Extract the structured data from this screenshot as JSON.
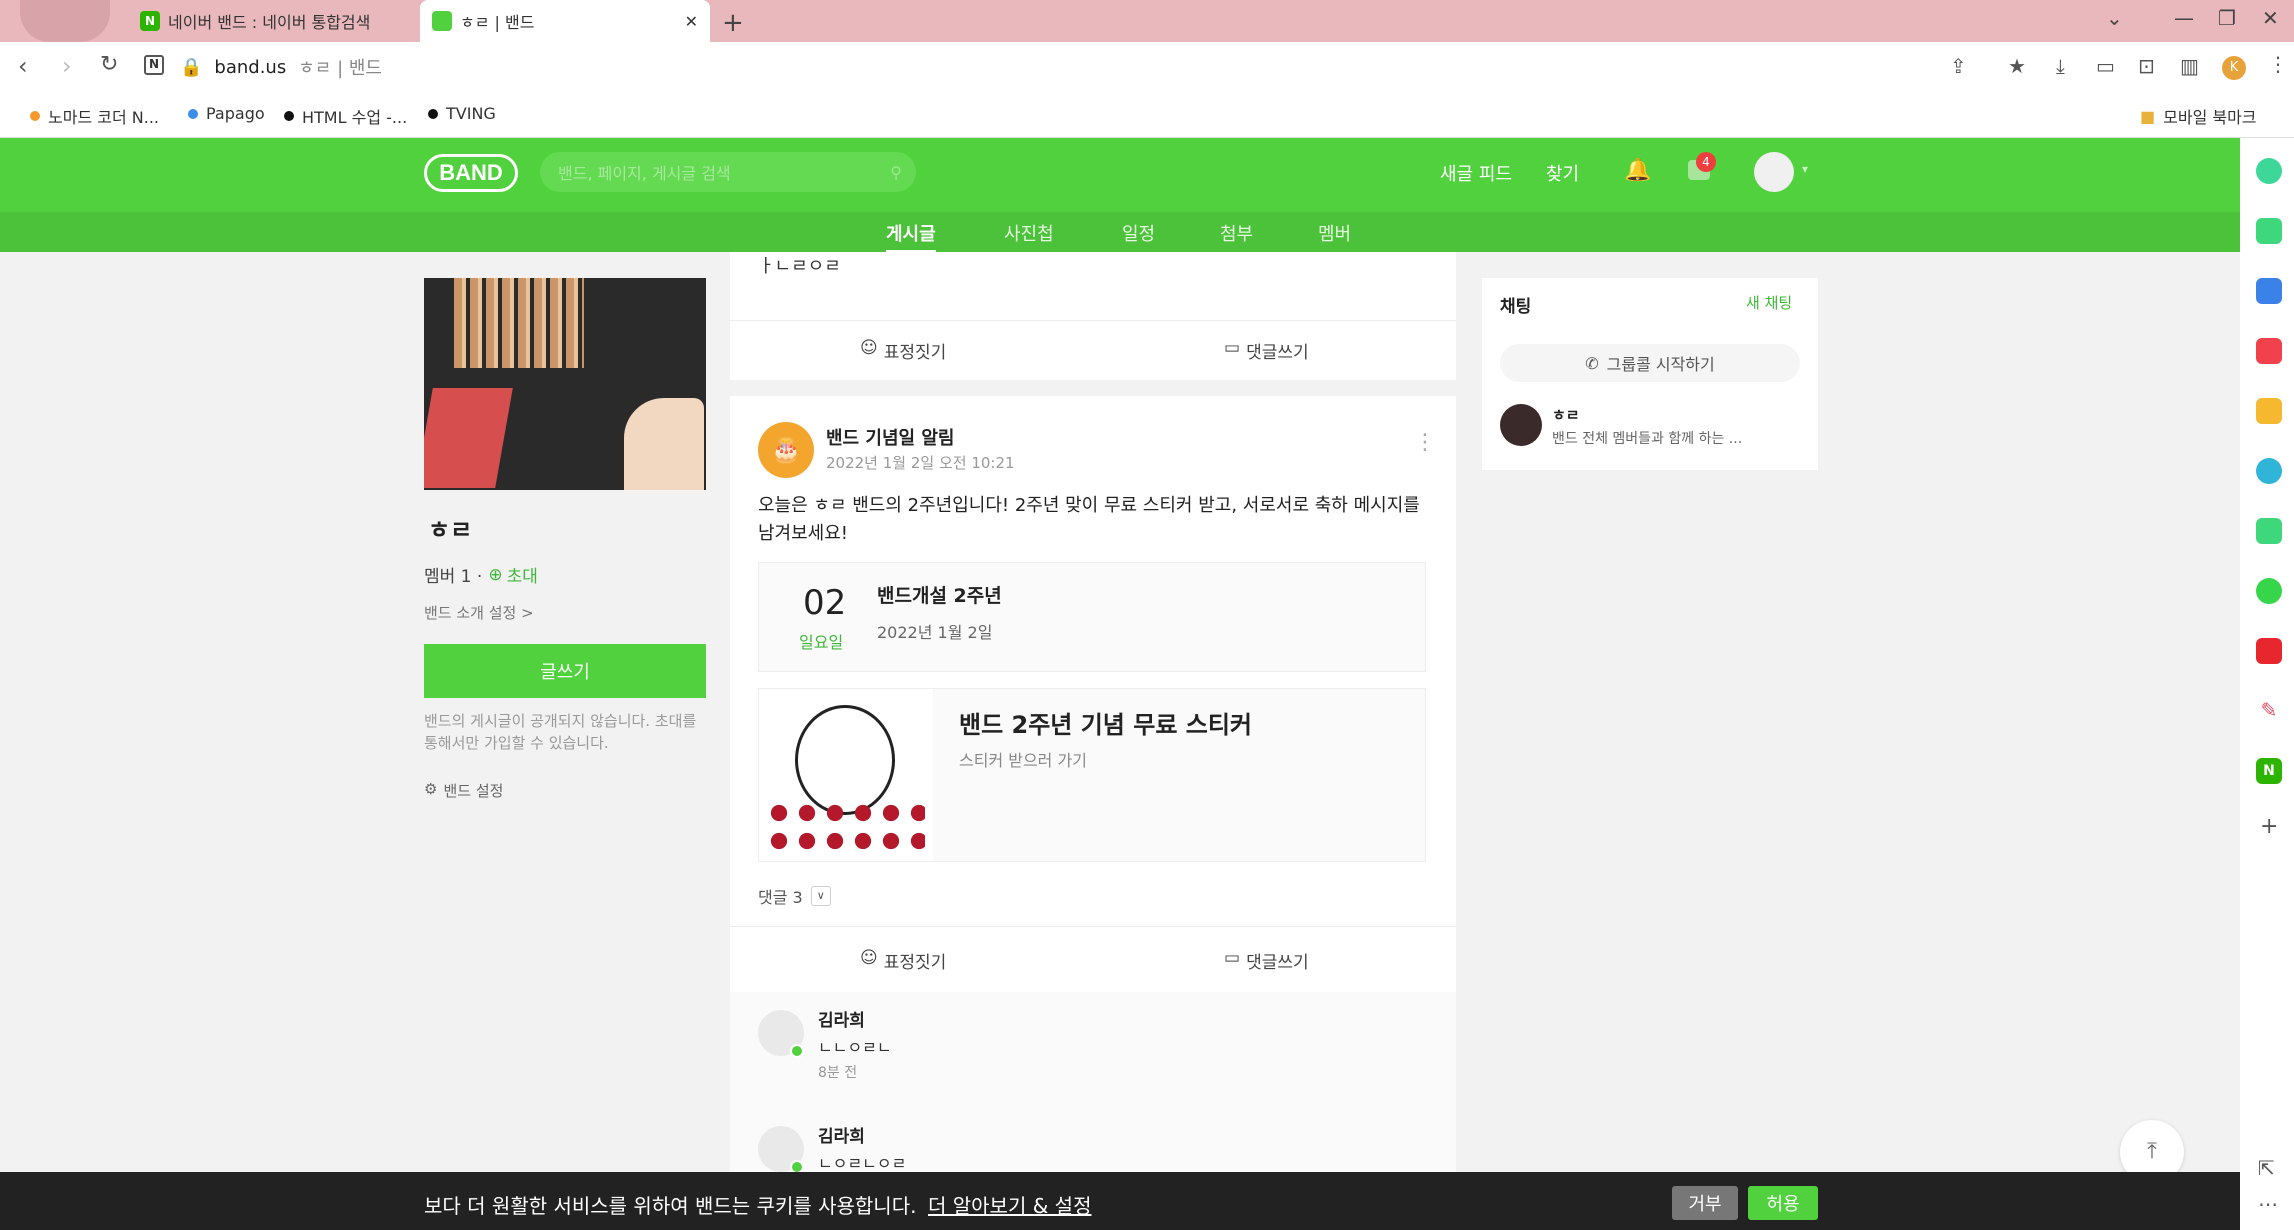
{
  "browser": {
    "tabs": [
      {
        "label": "네이버 밴드 : 네이버 통합검색"
      },
      {
        "label": "ㅎㄹ | 밴드"
      }
    ],
    "url": "band.us",
    "url_suffix": "ㅎㄹ | 밴드",
    "bookmarks": [
      {
        "label": "노마드 코더 N..."
      },
      {
        "label": "Papago"
      },
      {
        "label": "HTML 수업 -..."
      },
      {
        "label": "TVING"
      }
    ],
    "mobile_bookmarks": "모바일 북마크",
    "profile_initial": "K"
  },
  "band": {
    "logo": "BAND",
    "search_placeholder": "밴드, 페이지, 게시글 검색",
    "header_links": {
      "new_feed": "새글 피드",
      "find": "찾기"
    },
    "notif_count": "4",
    "nav": [
      {
        "label": "게시글"
      },
      {
        "label": "사진첩"
      },
      {
        "label": "일정"
      },
      {
        "label": "첨부"
      },
      {
        "label": "멤버"
      }
    ]
  },
  "left": {
    "band_name": "ㅎㄹ",
    "members": "멤버 1 ·",
    "invite": "초대",
    "intro_settings": "밴드 소개 설정 >",
    "write_button": "글쓰기",
    "notice": "밴드의 게시글이 공개되지 않습니다. 초대를 통해서만 가입할 수 있습니다.",
    "settings": "밴드 설정"
  },
  "prev_post": {
    "tail_text": "ㅏㄴㄹㅇㄹ",
    "react": "표정짓기",
    "comment": "댓글쓰기"
  },
  "post": {
    "author": "밴드 기념일 알림",
    "time": "2022년 1월 2일 오전 10:21",
    "body": "오늘은 ㅎㄹ 밴드의 2주년입니다! 2주년 맞이 무료 스티커 받고, 서로서로 축하 메시지를 남겨보세요!",
    "event": {
      "day": "02",
      "weekday": "일요일",
      "title": "밴드개설 2주년",
      "date": "2022년 1월 2일"
    },
    "sticker": {
      "title": "밴드 2주년 기념 무료 스티커",
      "sub": "스티커 받으러 가기"
    },
    "comments_count": "댓글 3",
    "react": "표정짓기",
    "comment": "댓글쓰기",
    "comments": [
      {
        "name": "김라희",
        "text": "ㄴㄴㅇㄹㄴ",
        "time": "8분 전"
      },
      {
        "name": "김라희",
        "text": "ㄴㅇㄹㄴㅇㄹ",
        "time": ""
      }
    ]
  },
  "chat": {
    "title": "채팅",
    "new_chat": "새 채팅",
    "start_group": "그룹콜 시작하기",
    "item": {
      "name": "ㅎㄹ",
      "preview": "밴드 전체 멤버들과 함께 하는 ..."
    }
  },
  "cookie": {
    "text": "보다 더 원활한 서비스를 위하여 밴드는 쿠키를 사용합니다.",
    "link": "더 알아보기 & 설정",
    "reject": "거부",
    "accept": "허용"
  }
}
